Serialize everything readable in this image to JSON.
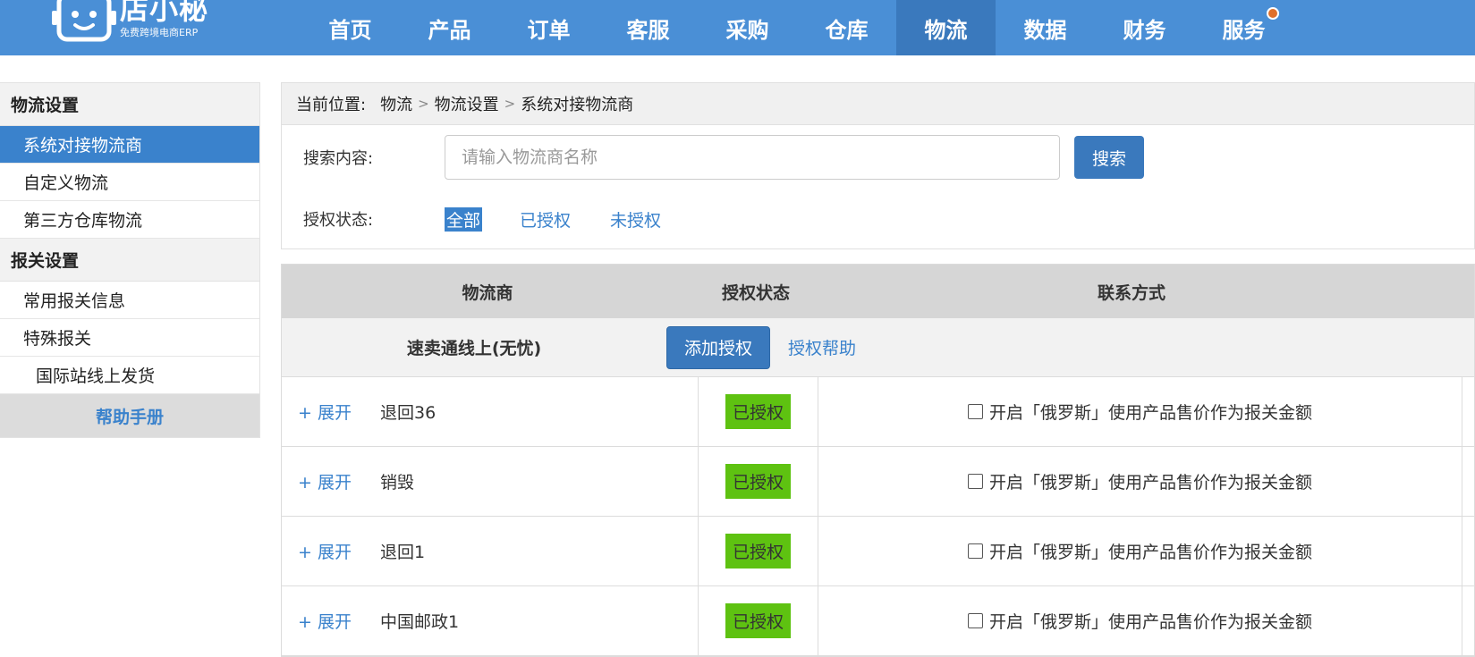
{
  "brand": {
    "name": "店小秘",
    "tagline": "免费跨境电商ERP"
  },
  "nav": {
    "items": [
      "首页",
      "产品",
      "订单",
      "客服",
      "采购",
      "仓库",
      "物流",
      "数据",
      "财务",
      "服务"
    ],
    "active": "物流"
  },
  "sidebar": {
    "group1": "物流设置",
    "item1": "系统对接物流商",
    "item2": "自定义物流",
    "item3": "第三方仓库物流",
    "group2": "报关设置",
    "item4": "常用报关信息",
    "item5": "特殊报关",
    "item6": "国际站线上发货",
    "help": "帮助手册"
  },
  "breadcrumb": {
    "prefix": "当前位置:",
    "level1": "物流",
    "level2": "物流设置",
    "current": "系统对接物流商"
  },
  "search": {
    "label": "搜索内容:",
    "placeholder": "请输入物流商名称",
    "button": "搜索"
  },
  "auth_filter": {
    "label": "授权状态:",
    "options": [
      "全部",
      "已授权",
      "未授权"
    ],
    "selected": "全部"
  },
  "table": {
    "headers": {
      "provider": "物流商",
      "status": "授权状态",
      "contact": "联系方式"
    },
    "provider": {
      "name": "速卖通线上(无忧)",
      "add_button": "添加授权",
      "help_link": "授权帮助"
    },
    "rows": [
      {
        "expand": "+ 展开",
        "name": "退回36",
        "status": "已授权",
        "option": "开启「俄罗斯」使用产品售价作为报关金额"
      },
      {
        "expand": "+ 展开",
        "name": "销毁",
        "status": "已授权",
        "option": "开启「俄罗斯」使用产品售价作为报关金额"
      },
      {
        "expand": "+ 展开",
        "name": "退回1",
        "status": "已授权",
        "option": "开启「俄罗斯」使用产品售价作为报关金额"
      },
      {
        "expand": "+ 展开",
        "name": "中国邮政1",
        "status": "已授权",
        "option": "开启「俄罗斯」使用产品售价作为报关金额"
      }
    ]
  },
  "colors": {
    "nav_bg": "#4a8fd6",
    "nav_active": "#3a79bd",
    "primary": "#3a82cc",
    "authorized_badge": "#5ec211",
    "notice_dot": "#e0702a"
  }
}
